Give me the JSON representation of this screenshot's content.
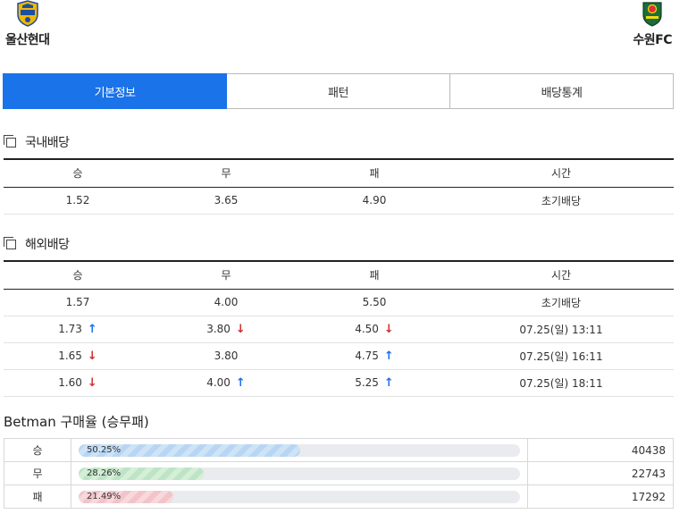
{
  "match": {
    "home": {
      "name": "울산현대",
      "logo_icon": "ulsan-crest-icon",
      "color": "#f2b705"
    },
    "away": {
      "name": "수원FC",
      "logo_icon": "suwonfc-crest-icon",
      "color": "#1b6e3a"
    }
  },
  "tabs": [
    {
      "label": "기본정보",
      "active": true
    },
    {
      "label": "패턴",
      "active": false
    },
    {
      "label": "배당통계",
      "active": false
    }
  ],
  "domestic": {
    "title": "국내배당",
    "headers": [
      "승",
      "무",
      "패",
      "시간"
    ],
    "rows": [
      {
        "win": "1.52",
        "draw": "3.65",
        "lose": "4.90",
        "time": "초기배당"
      }
    ]
  },
  "overseas": {
    "title": "해외배당",
    "headers": [
      "승",
      "무",
      "패",
      "시간"
    ],
    "rows": [
      {
        "win": "1.57",
        "draw": "4.00",
        "lose": "5.50",
        "time": "초기배당",
        "win_dir": "",
        "draw_dir": "",
        "lose_dir": ""
      },
      {
        "win": "1.73",
        "draw": "3.80",
        "lose": "4.50",
        "time": "07.25(일) 13:11",
        "win_dir": "up",
        "draw_dir": "down",
        "lose_dir": "down"
      },
      {
        "win": "1.65",
        "draw": "3.80",
        "lose": "4.75",
        "time": "07.25(일) 16:11",
        "win_dir": "down",
        "draw_dir": "",
        "lose_dir": "up"
      },
      {
        "win": "1.60",
        "draw": "4.00",
        "lose": "5.25",
        "time": "07.25(일) 18:11",
        "win_dir": "down",
        "draw_dir": "up",
        "lose_dir": "up"
      }
    ]
  },
  "betman": {
    "title": "Betman 구매율 (승무패)",
    "rows": [
      {
        "label": "승",
        "percent_text": "50.25%",
        "percent": 50.25,
        "count": "40438",
        "kind": "win"
      },
      {
        "label": "무",
        "percent_text": "28.26%",
        "percent": 28.26,
        "count": "22743",
        "kind": "draw"
      },
      {
        "label": "패",
        "percent_text": "21.49%",
        "percent": 21.49,
        "count": "17292",
        "kind": "lose"
      }
    ]
  },
  "colors": {
    "accent": "#1a73e8",
    "up": "#1a73e8",
    "down": "#d32f2f"
  }
}
